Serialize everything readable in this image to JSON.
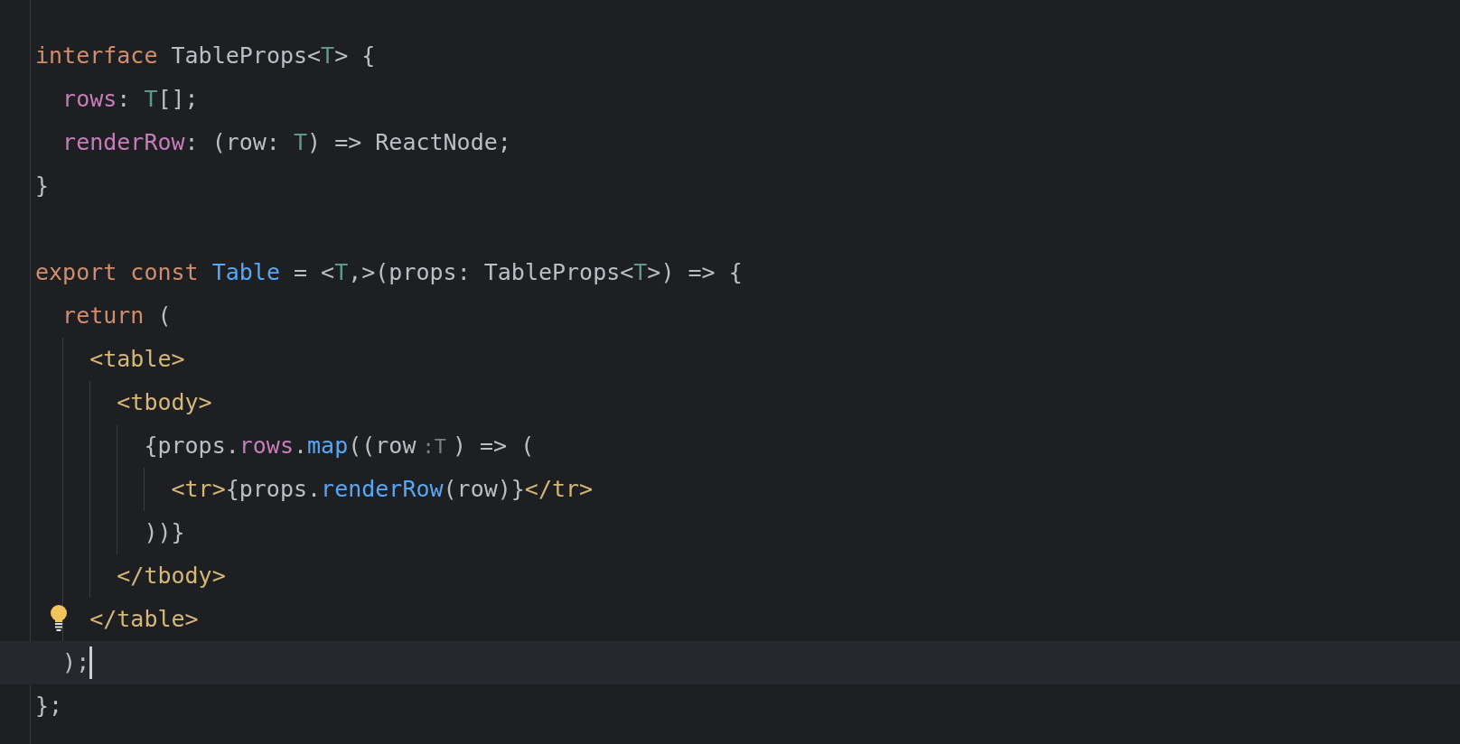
{
  "editor": {
    "lines": [
      {
        "tokens": [
          {
            "kind": "keyword",
            "text": "interface"
          },
          {
            "kind": "plain",
            "text": " TableProps<"
          },
          {
            "kind": "type",
            "text": "T"
          },
          {
            "kind": "plain",
            "text": "> {"
          }
        ]
      },
      {
        "tokens": [
          {
            "kind": "property",
            "text": "  rows"
          },
          {
            "kind": "plain",
            "text": ": "
          },
          {
            "kind": "type",
            "text": "T"
          },
          {
            "kind": "plain",
            "text": "[];"
          }
        ]
      },
      {
        "tokens": [
          {
            "kind": "property",
            "text": "  renderRow"
          },
          {
            "kind": "plain",
            "text": ": (row: "
          },
          {
            "kind": "type",
            "text": "T"
          },
          {
            "kind": "plain",
            "text": ") => ReactNode;"
          }
        ]
      },
      {
        "tokens": [
          {
            "kind": "plain",
            "text": "}"
          }
        ]
      },
      {
        "blank_line_before": true,
        "tokens": [
          {
            "kind": "keyword",
            "text": "export const "
          },
          {
            "kind": "function",
            "text": "Table"
          },
          {
            "kind": "plain",
            "text": " = <"
          },
          {
            "kind": "type",
            "text": "T"
          },
          {
            "kind": "plain",
            "text": ",>(props: TableProps<"
          },
          {
            "kind": "type",
            "text": "T"
          },
          {
            "kind": "plain",
            "text": ">) => {"
          }
        ]
      },
      {
        "tokens": [
          {
            "kind": "keyword",
            "text": "  return"
          },
          {
            "kind": "plain",
            "text": " ("
          }
        ]
      },
      {
        "tokens": [
          {
            "kind": "tag",
            "text": "    <table>"
          }
        ]
      },
      {
        "tokens": [
          {
            "kind": "tag",
            "text": "      <tbody>"
          }
        ]
      },
      {
        "tokens": [
          {
            "kind": "plain",
            "text": "        {props."
          },
          {
            "kind": "property",
            "text": "rows"
          },
          {
            "kind": "plain",
            "text": "."
          },
          {
            "kind": "function",
            "text": "map"
          },
          {
            "kind": "plain",
            "text": "((row"
          },
          {
            "kind": "hint",
            "text": ":T"
          },
          {
            "kind": "plain",
            "text": ") => ("
          }
        ]
      },
      {
        "tokens": [
          {
            "kind": "tag",
            "text": "          <tr>"
          },
          {
            "kind": "plain",
            "text": "{props."
          },
          {
            "kind": "function",
            "text": "renderRow"
          },
          {
            "kind": "plain",
            "text": "(row)}"
          },
          {
            "kind": "tag",
            "text": "</tr>"
          }
        ]
      },
      {
        "tokens": [
          {
            "kind": "plain",
            "text": "        ))}"
          }
        ]
      },
      {
        "tokens": [
          {
            "kind": "tag",
            "text": "      </tbody>"
          }
        ]
      },
      {
        "lightbulb": true,
        "tokens": [
          {
            "kind": "tag",
            "text": "    </table>"
          }
        ]
      },
      {
        "current": true,
        "tokens": [
          {
            "kind": "plain",
            "text": "  );"
          }
        ]
      },
      {
        "tokens": [
          {
            "kind": "plain",
            "text": "};"
          }
        ]
      }
    ]
  }
}
